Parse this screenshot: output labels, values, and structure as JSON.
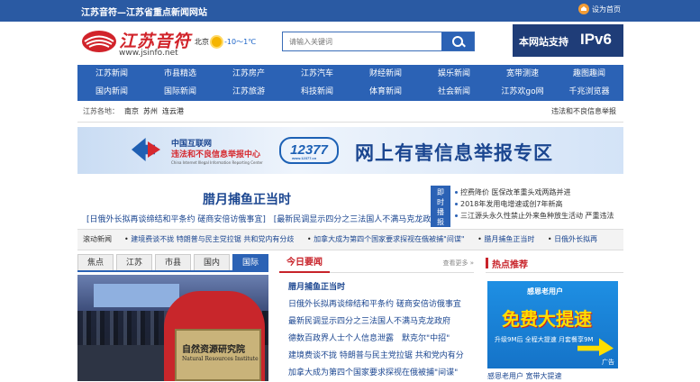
{
  "topbar": {
    "title": "江苏音符—江苏省重点新闻网站",
    "home_label": "设为首页"
  },
  "logo": {
    "name": "江苏音符",
    "url": "www.jsinfo.net"
  },
  "weather": {
    "city": "北京",
    "temp": "-10～1℃"
  },
  "search": {
    "placeholder": "请输入关键词"
  },
  "ipv6": {
    "text": "本网站支持",
    "badge": "IPv6"
  },
  "nav": [
    [
      "江苏新闻",
      "市县精选",
      "江苏房产",
      "江苏汽车",
      "财经新闻",
      "娱乐新闻",
      "宽带测速",
      "趣图趣闻"
    ],
    [
      "国内新闻",
      "国际新闻",
      "江苏旅游",
      "科技新闻",
      "体育新闻",
      "社会新闻",
      "江苏欢go网",
      "千兆浏览器"
    ]
  ],
  "regions": {
    "label": "江苏各地：",
    "cities": [
      "南京",
      "苏州",
      "连云港"
    ],
    "report": "违法和不良信息举报"
  },
  "banner": {
    "org_line1": "中国互联网",
    "org_line2": "违法和不良信息举报中心",
    "org_en": "China Internet Illegal Information Reporting Center",
    "number": "12377",
    "number_sub": "www.12377.cn",
    "title": "网上有害信息举报专区"
  },
  "headline": {
    "title": "腊月捕鱼正当时",
    "sub1": "[日俄外长拟再谈缔结和平条约 磋商安倍访俄事宜]",
    "sub2": "[最新民调显示四分之三法国人不满马克龙政府]"
  },
  "instant": {
    "label": "即时播报",
    "items": [
      "控费降价 医保改革重头戏两路并进",
      "2018年发用电增速或创7年新高",
      "三江源头永久性禁止外来鱼种放生活动 严重违法"
    ]
  },
  "ticker": {
    "label": "滚动新闻",
    "items": [
      "建境费谈不拢 特朗普与民主党拉锯 共和党内有分歧",
      "加拿大成为第四个国家要求探视在俄被捕\"间谍\"",
      "腊月捕鱼正当时",
      "日俄外长拟再"
    ]
  },
  "tabs": [
    "焦点",
    "江苏",
    "市县",
    "国内",
    "国际"
  ],
  "active_tab": "国际",
  "photo": {
    "plaque_cn": "自然资源研究院",
    "plaque_en": "Natural Resources Institute"
  },
  "today": {
    "title": "今日要闻",
    "more": "查看更多 »",
    "items": [
      "腊月捕鱼正当时",
      "日俄外长拟再谈缔结和平条约 磋商安倍访俄事宜",
      "最新民调显示四分之三法国人不满马克龙政府",
      "德数百政界人士个人信息泄露　默克尔\"中招\"",
      "建境费谈不拢 特朗普与民主党拉锯 共和党内有分",
      "加拿大成为第四个国家要求探视在俄被捕\"间谍\""
    ]
  },
  "hot": {
    "title": "热点推荐",
    "ad_top": "感恩老用户",
    "ad_big": "免费大提速",
    "ad_line": "升级9M后 全程大提速 月套餐享9M",
    "ad_tag": "广告",
    "caption": "感恩老用户 宽带大提速"
  },
  "colors": {
    "brand_blue": "#2b62b5",
    "accent_red": "#c8232a",
    "link_blue": "#1b4690"
  }
}
